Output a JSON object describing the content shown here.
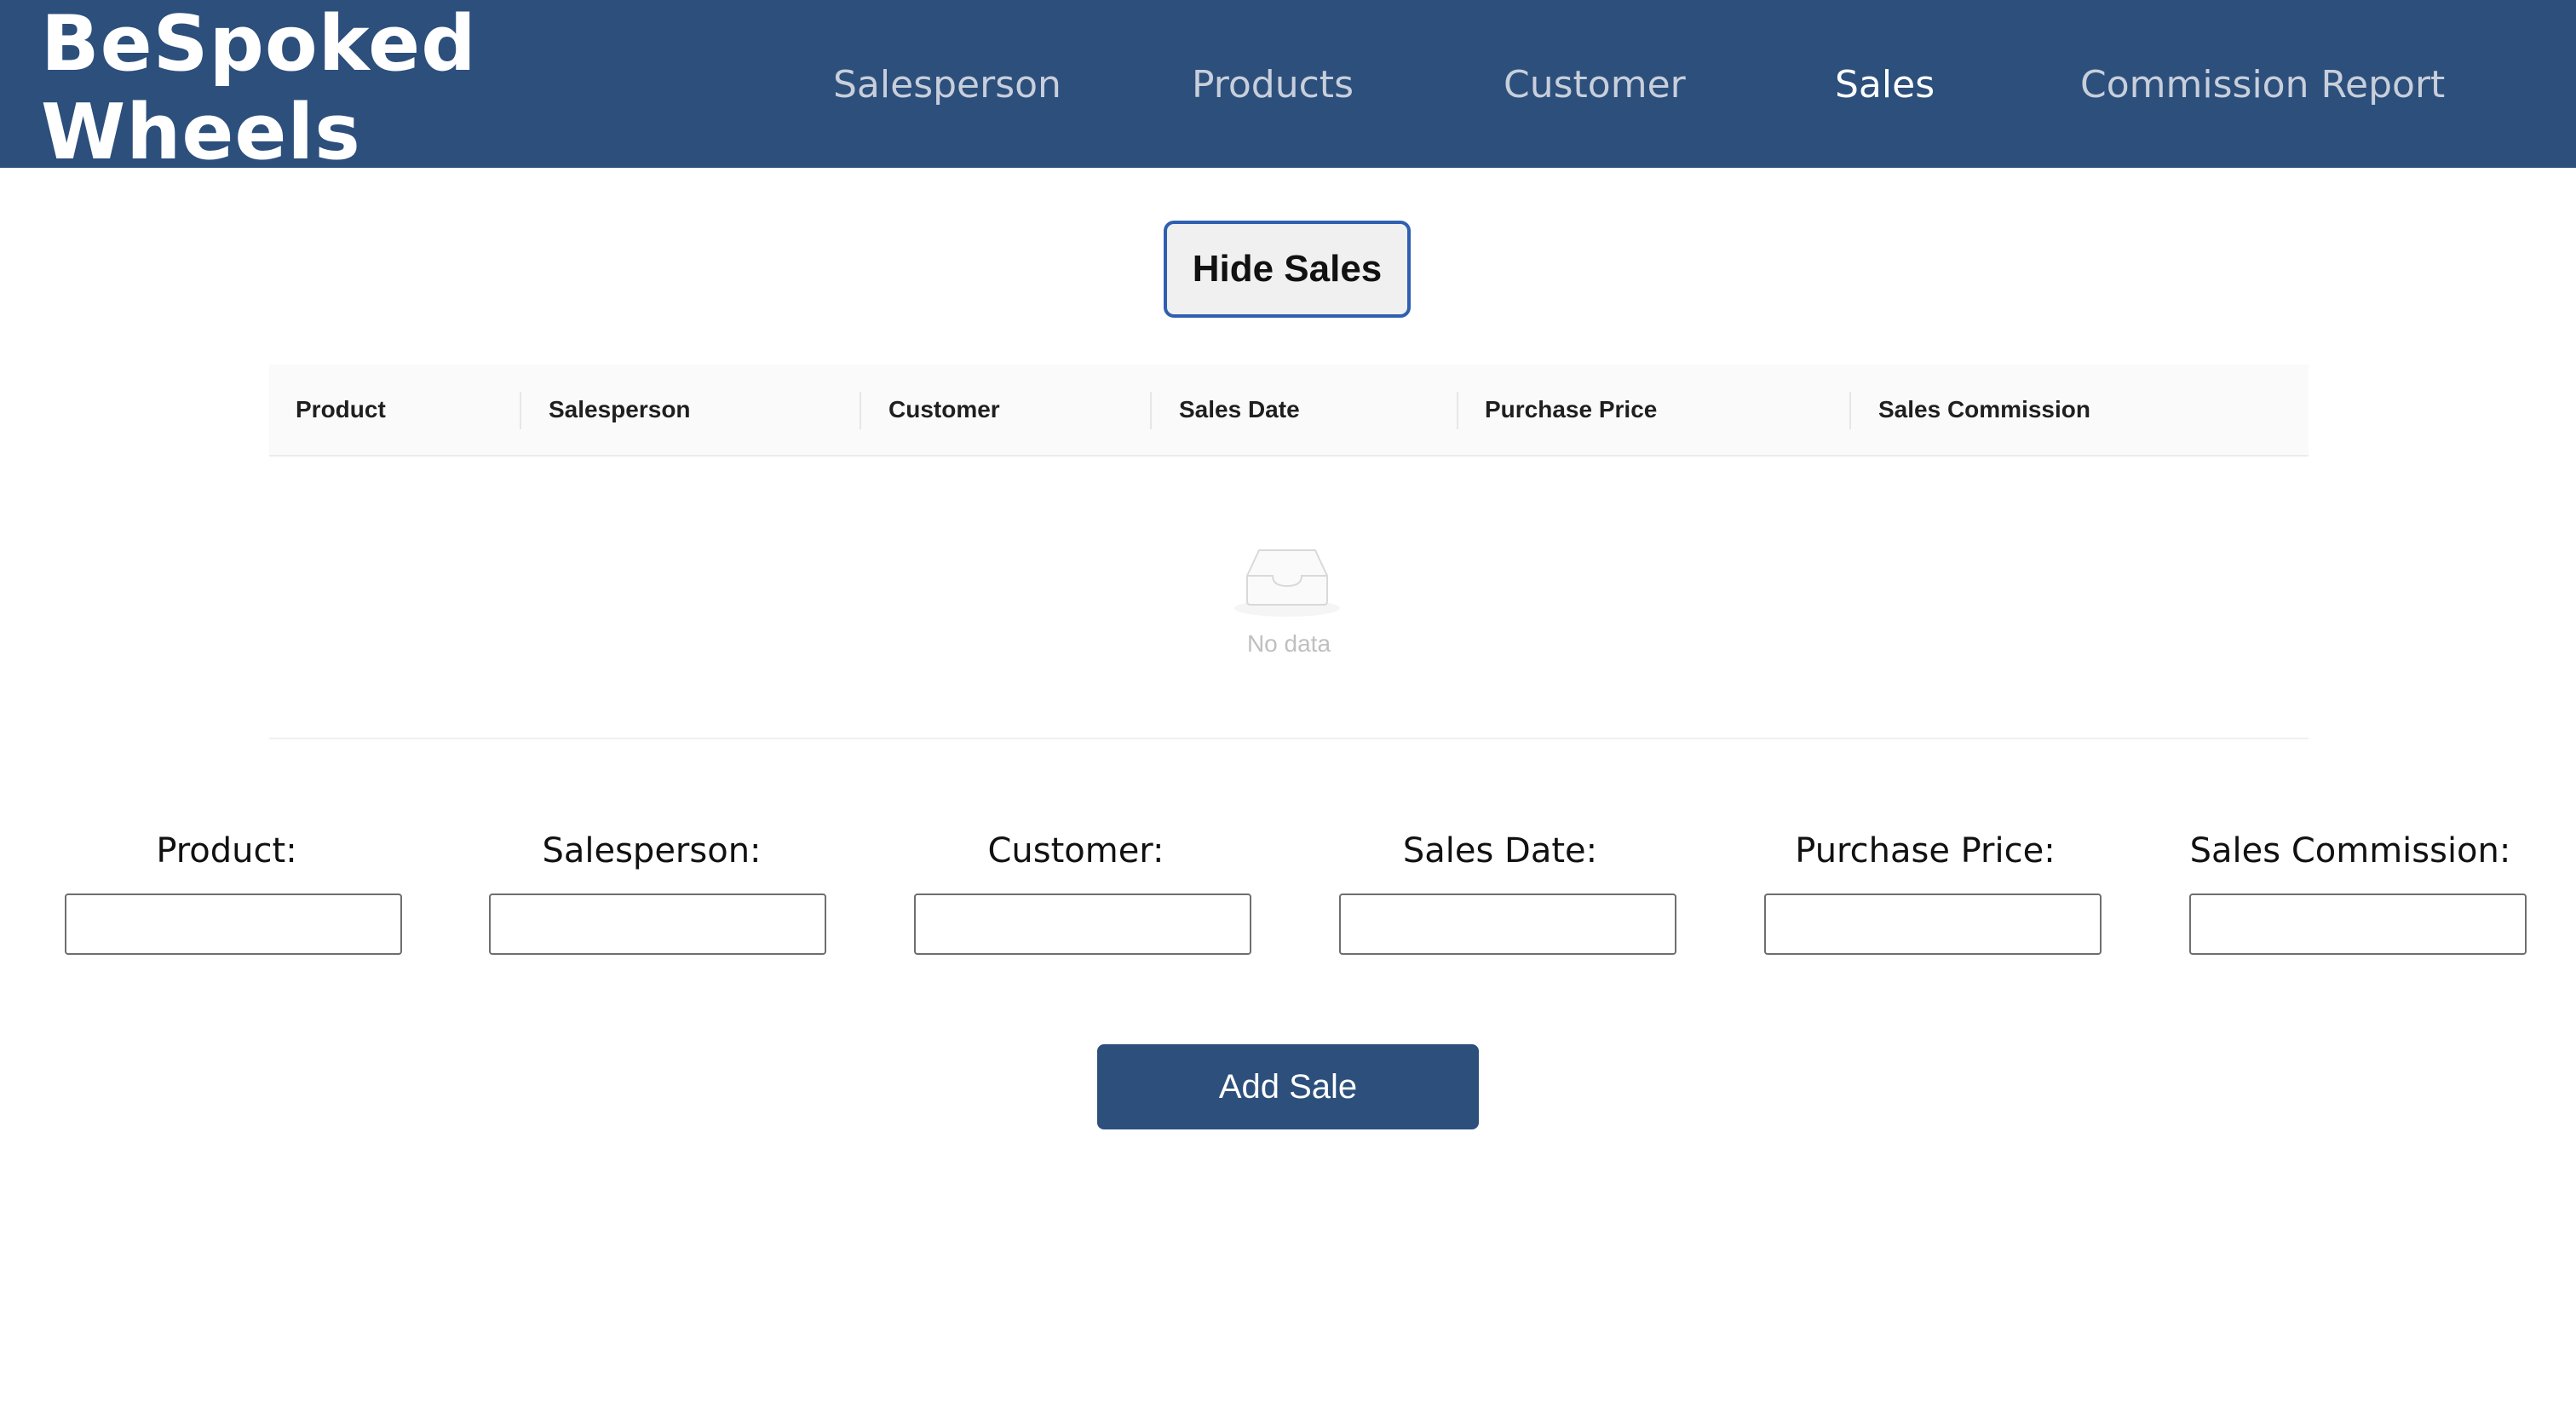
{
  "brand": {
    "line1": "BeSpoked",
    "line2": "Wheels"
  },
  "nav": {
    "items": [
      {
        "label": "Salesperson",
        "active": false
      },
      {
        "label": "Products",
        "active": false
      },
      {
        "label": "Customer",
        "active": false
      },
      {
        "label": "Sales",
        "active": true
      },
      {
        "label": "Commission Report",
        "active": false
      }
    ]
  },
  "toggle_button": {
    "label": "Hide Sales"
  },
  "table": {
    "columns": [
      "Product",
      "Salesperson",
      "Customer",
      "Sales Date",
      "Purchase Price",
      "Sales Commission"
    ],
    "rows": [],
    "empty_text": "No data",
    "empty_icon": "inbox-icon"
  },
  "form": {
    "fields": [
      {
        "label": "Product:",
        "value": "",
        "placeholder": ""
      },
      {
        "label": "Salesperson:",
        "value": "",
        "placeholder": ""
      },
      {
        "label": "Customer:",
        "value": "",
        "placeholder": ""
      },
      {
        "label": "Sales Date:",
        "value": "",
        "placeholder": ""
      },
      {
        "label": "Purchase Price:",
        "value": "",
        "placeholder": ""
      },
      {
        "label": "Sales Commission:",
        "value": "",
        "placeholder": ""
      }
    ],
    "submit_label": "Add Sale"
  },
  "colors": {
    "brand": "#2c4f7c",
    "nav_inactive": "#c8cfdb",
    "nav_active": "#ffffff",
    "button_focus_border": "#2f5fb0"
  }
}
